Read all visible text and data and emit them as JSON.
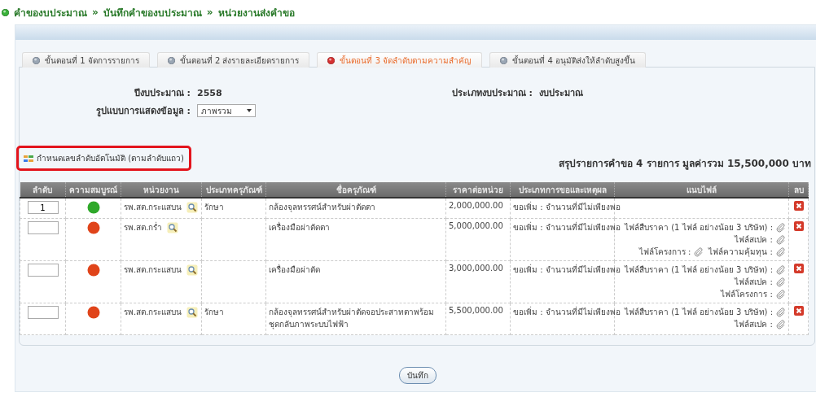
{
  "breadcrumb": {
    "items": [
      "คำของบประมาณ",
      "บันทึกคำของบประมาณ",
      "หน่วยงานส่งคำขอ"
    ],
    "separators": [
      "»",
      "»"
    ]
  },
  "tabs": [
    {
      "label": "ขั้นตอนที่ 1 จัดการรายการ",
      "selected": false
    },
    {
      "label": "ขั้นตอนที่ 2 ส่งรายละเอียดรายการ",
      "selected": false
    },
    {
      "label": "ขั้นตอนที่ 3 จัดลำดับตามความสำคัญ",
      "selected": true
    },
    {
      "label": "ขั้นตอนที่ 4 อนุมัติส่งให้ลำดับสูงขึ้น",
      "selected": false
    }
  ],
  "fields": {
    "year_label": "ปีงบประมาณ :",
    "year": "2558",
    "budget_type_label": "ประเภทงบประมาณ :",
    "budget_type": "งบประมาณ",
    "display_label": "รูปแบบการแสดงข้อมูล :",
    "display_value": "ภาพรวม"
  },
  "auto_number_link": "กำหนดเลขลำดับอัตโนมัติ (ตามลำดับแถว)",
  "summary": "สรุปรายการคำขอ 4 รายการ มูลค่ารวม 15,500,000 บาท",
  "table": {
    "columns": [
      "ลำดับ",
      "ความสมบูรณ์",
      "หน่วยงาน",
      "ประเภทครุภัณฑ์",
      "ชื่อครุภัณฑ์",
      "ราคาต่อหน่วย",
      "ประเภทการขอและเหตุผล",
      "แนบไฟล์",
      "ลบ"
    ],
    "rows": [
      {
        "order": "1",
        "color": "#2fa82a",
        "unit": "รพ.สต.กระแสบน",
        "category": "รักษา",
        "name": "กล้องจุลทรรศน์สำหรับผ่าตัดตา",
        "price": "2,000,000.00",
        "reason": "ขอเพิ่ม : จำนวนที่มีไม่เพียงพอ"
      },
      {
        "color": "#e0441a",
        "unit": "รพ.สต.กร่ำ",
        "name": "เครื่องมือผ่าตัดตา",
        "price": "5,000,000.00",
        "reason": "ขอเพิ่ม : จำนวนที่มีไม่เพียงพอ",
        "files": [
          [
            "ไฟล์สืบราคา (1 ไฟล์ อย่างน้อย 3 บริษัท) :"
          ],
          [
            "ไฟล์สเปค :"
          ],
          [
            "ไฟล์โครงการ :",
            "ไฟล์ความคุ้มทุน :"
          ]
        ]
      },
      {
        "color": "#e0441a",
        "unit": "รพ.สต.กระแสบน",
        "name": "เครื่องมือผ่าตัด",
        "price": "3,000,000.00",
        "reason": "ขอเพิ่ม : จำนวนที่มีไม่เพียงพอ",
        "files": [
          [
            "ไฟล์สืบราคา (1 ไฟล์ อย่างน้อย 3 บริษัท) :"
          ],
          [
            "ไฟล์สเปค :"
          ],
          [
            "ไฟล์โครงการ :"
          ]
        ]
      },
      {
        "color": "#e0441a",
        "unit": "รพ.สต.กระแสบน",
        "category": "รักษา",
        "name": "กล้องจุลทรรศน์สำหรับผ่าตัดจอประสาทตาพร้อมชุดกลับภาพระบบไฟฟ้า",
        "price": "5,500,000.00",
        "reason": "ขอเพิ่ม : จำนวนที่มีไม่เพียงพอ",
        "files": [
          [
            "ไฟล์สืบราคา (1 ไฟล์ อย่างน้อย 3 บริษัท) :"
          ],
          [
            "ไฟล์สเปค :"
          ]
        ]
      }
    ]
  },
  "save_button": "บันทึก"
}
